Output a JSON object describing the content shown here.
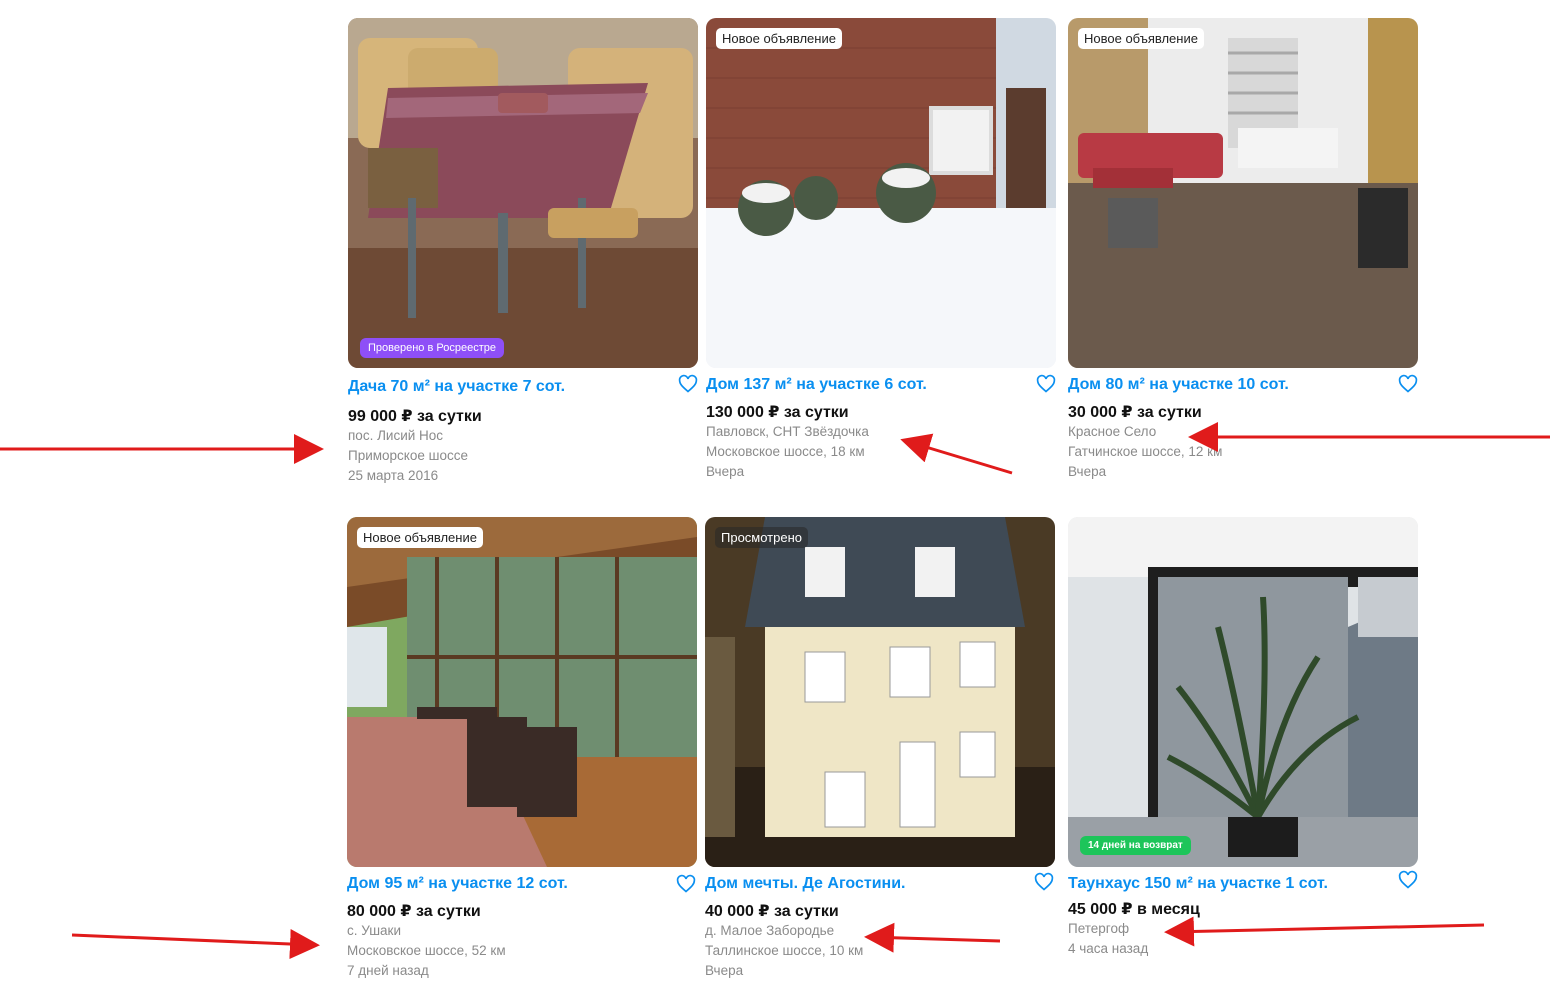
{
  "listings": [
    {
      "title": "Дача 70 м² на участке 7 сот.",
      "price": "99 000 ₽ за сутки",
      "location": "пос. Лисий Нос",
      "highway": "Приморское шоссе",
      "date": "25 марта 2016",
      "badge_bottom": "Проверено в Росреестре"
    },
    {
      "title": "Дом 137 м² на участке 6 сот.",
      "price": "130 000 ₽ за сутки",
      "location": "Павловск, СНТ Звёздочка",
      "highway": "Московское шоссе, 18 км",
      "date": "Вчера",
      "badge_top": "Новое объявление"
    },
    {
      "title": "Дом 80 м² на участке 10 сот.",
      "price": "30 000 ₽ за сутки",
      "location": "Красное Село",
      "highway": "Гатчинское шоссе, 12 км",
      "date": "Вчера",
      "badge_top": "Новое объявление"
    },
    {
      "title": "Дом 95 м² на участке 12 сот.",
      "price": "80 000 ₽ за сутки",
      "location": "с. Ушаки",
      "highway": "Московское шоссе, 52 км",
      "date": "7 дней назад",
      "badge_top": "Новое объявление"
    },
    {
      "title": "Дом мечты. Де Агостини.",
      "price": "40 000 ₽ за сутки",
      "location": "д. Малое Забородье",
      "highway": "Таллинское шоссе, 10 км",
      "date": "Вчера",
      "badge_top": "Просмотрено"
    },
    {
      "title": "Таунхаус 150 м² на участке 1 сот.",
      "price": "45 000 ₽ в месяц",
      "location": "Петергоф",
      "date": "4 часа назад",
      "badge_bottom": "14 дней на возврат"
    }
  ],
  "colors": {
    "title": "#0a8ff0",
    "arrow": "#e01b1b",
    "rosreestr_badge": "#8e4ff7",
    "return_badge": "#1dc55a"
  },
  "icons": [
    "heart-icon",
    "arrow-annotation"
  ]
}
